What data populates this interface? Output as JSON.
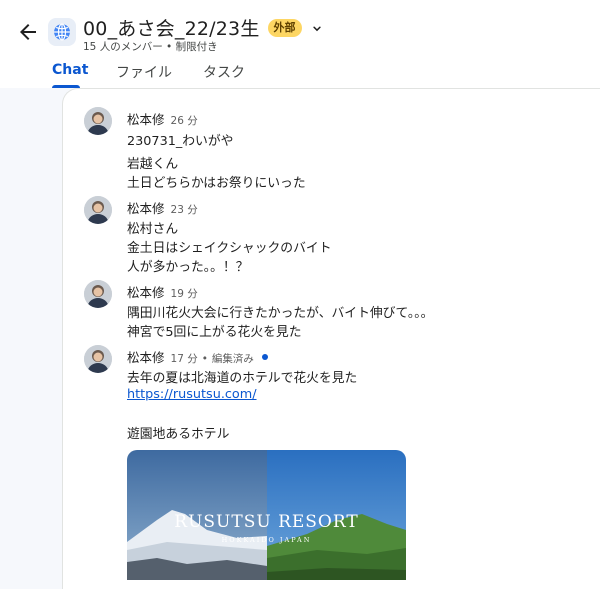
{
  "header": {
    "title": "00_あさ会_22/23生",
    "external_badge": "外部",
    "subtitle": "15 人のメンバー • 制限付き",
    "tabs": [
      "Chat",
      "ファイル",
      "タスク"
    ],
    "active_tab": "Chat"
  },
  "messages": [
    {
      "sender": "松本修",
      "time": "26 分",
      "lines": [
        "230731_わいがや",
        "岩越くん",
        "土日どちらかはお祭りにいった"
      ]
    },
    {
      "sender": "松本修",
      "time": "23 分",
      "lines": [
        "松村さん",
        "金土日はシェイクシャックのバイト",
        "人が多かった。。！？"
      ]
    },
    {
      "sender": "松本修",
      "time": "19 分",
      "lines": [
        "隅田川花火大会に行きたかったが、バイト伸びて。。。",
        "神宮で5回に上がる花火を見た"
      ]
    },
    {
      "sender": "松本修",
      "time": "17 分",
      "edited": "編集済み",
      "lines": [
        "去年の夏は北海道のホテルで花火を見た"
      ],
      "link": "https://rusutsu.com/",
      "after_link": "遊園地あるホテル",
      "preview": {
        "brand_main": "RUSUTSU RESORT",
        "brand_sub": "HOKKAIDO JAPAN"
      }
    }
  ],
  "colors": {
    "accent": "#0b57d0",
    "badge_bg": "#fdd663",
    "page_bg": "#f6f8fc"
  },
  "icons": [
    "back-arrow-icon",
    "globe-icon",
    "chevron-down-icon",
    "unread-dot"
  ]
}
